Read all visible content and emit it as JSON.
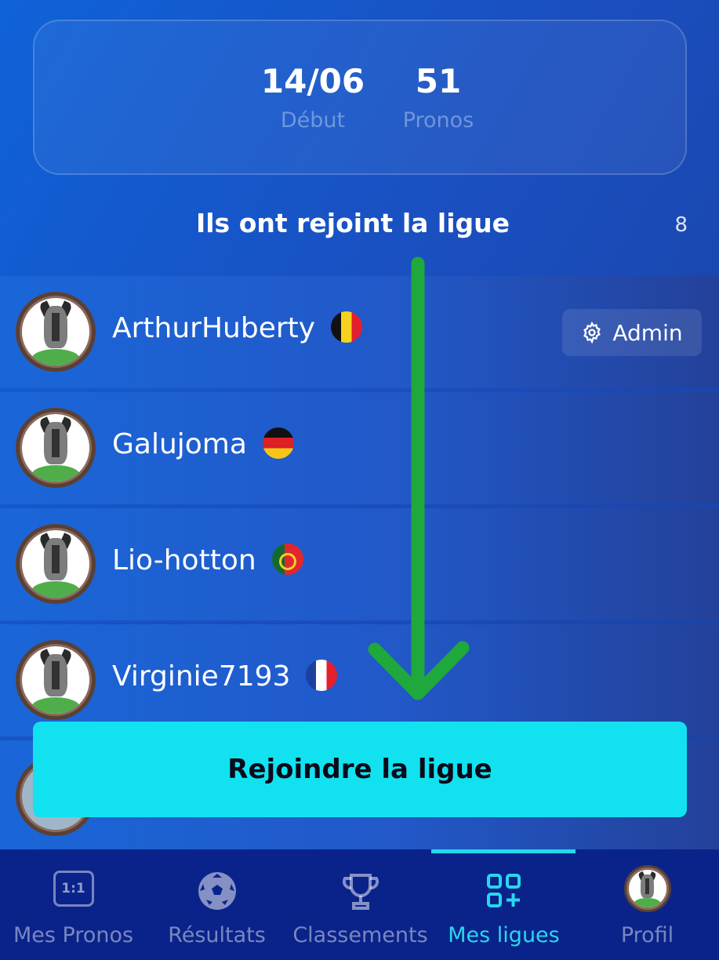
{
  "stats": {
    "start_value": "14/06",
    "start_label": "Début",
    "predictions_value": "51",
    "predictions_label": "Pronos"
  },
  "members_section": {
    "title": "Ils ont rejoint la ligue",
    "count": "8"
  },
  "members": [
    {
      "name": "ArthurHuberty",
      "flag": "belgium-flag-icon",
      "admin": true
    },
    {
      "name": "Galujoma",
      "flag": "germany-flag-icon",
      "admin": false
    },
    {
      "name": "Lio-hotton",
      "flag": "portugal-flag-icon",
      "admin": false
    },
    {
      "name": "Virginie7193",
      "flag": "france-flag-icon",
      "admin": false
    },
    {
      "name": "",
      "flag": "",
      "admin": false
    }
  ],
  "admin_badge": {
    "label": "Admin",
    "icon": "gear-icon"
  },
  "join_button": {
    "label": "Rejoindre la ligue",
    "color": "#12e2ef"
  },
  "annotation": {
    "icon": "green-down-arrow",
    "color": "#1fa83c"
  },
  "bottom_nav": {
    "items": [
      {
        "label": "Mes Pronos",
        "icon": "score-1-1-icon",
        "active": false,
        "icon_text": "1:1"
      },
      {
        "label": "Résultats",
        "icon": "soccer-ball-icon",
        "active": false
      },
      {
        "label": "Classements",
        "icon": "trophy-icon",
        "active": false
      },
      {
        "label": "Mes ligues",
        "icon": "grid-plus-icon",
        "active": true
      },
      {
        "label": "Profil",
        "icon": "profile-avatar-icon",
        "active": false
      }
    ],
    "active_color": "#2ad6ec"
  }
}
